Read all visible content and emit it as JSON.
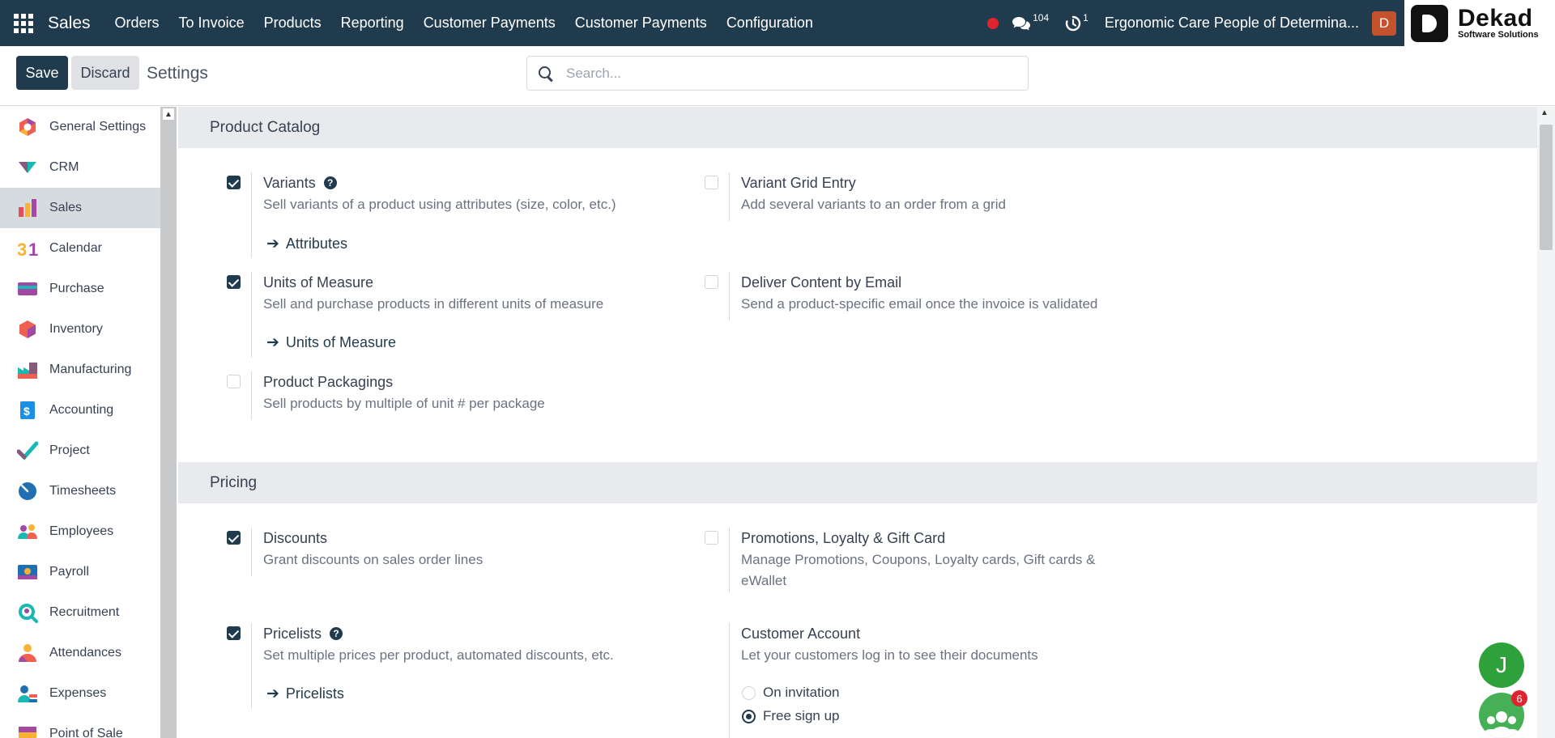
{
  "navbar": {
    "brand": "Sales",
    "menu": [
      "Orders",
      "To Invoice",
      "Products",
      "Reporting",
      "Customer Payments",
      "Customer Payments",
      "Configuration"
    ],
    "messages_count": "104",
    "activities_count": "1",
    "company": "Ergonomic Care People of Determina...",
    "user_initial": "D",
    "partner_logo": {
      "name": "Dekad",
      "tagline": "Software Solutions"
    }
  },
  "control": {
    "save_label": "Save",
    "discard_label": "Discard",
    "breadcrumb": "Settings",
    "search_placeholder": "Search..."
  },
  "sidebar": {
    "items": [
      {
        "label": "General Settings",
        "icon": "general-settings-icon",
        "active": false
      },
      {
        "label": "CRM",
        "icon": "crm-icon",
        "active": false
      },
      {
        "label": "Sales",
        "icon": "sales-icon",
        "active": true
      },
      {
        "label": "Calendar",
        "icon": "calendar-icon",
        "active": false
      },
      {
        "label": "Purchase",
        "icon": "purchase-icon",
        "active": false
      },
      {
        "label": "Inventory",
        "icon": "inventory-icon",
        "active": false
      },
      {
        "label": "Manufacturing",
        "icon": "manufacturing-icon",
        "active": false
      },
      {
        "label": "Accounting",
        "icon": "accounting-icon",
        "active": false
      },
      {
        "label": "Project",
        "icon": "project-icon",
        "active": false
      },
      {
        "label": "Timesheets",
        "icon": "timesheets-icon",
        "active": false
      },
      {
        "label": "Employees",
        "icon": "employees-icon",
        "active": false
      },
      {
        "label": "Payroll",
        "icon": "payroll-icon",
        "active": false
      },
      {
        "label": "Recruitment",
        "icon": "recruitment-icon",
        "active": false
      },
      {
        "label": "Attendances",
        "icon": "attendances-icon",
        "active": false
      },
      {
        "label": "Expenses",
        "icon": "expenses-icon",
        "active": false
      },
      {
        "label": "Point of Sale",
        "icon": "point-of-sale-icon",
        "active": false
      }
    ]
  },
  "sections": {
    "product_catalog": {
      "title": "Product Catalog",
      "variants": {
        "title": "Variants",
        "desc": "Sell variants of a product using attributes (size, color, etc.)",
        "checked": true,
        "link": "Attributes"
      },
      "variant_grid": {
        "title": "Variant Grid Entry",
        "desc": "Add several variants to an order from a grid",
        "checked": false
      },
      "uom": {
        "title": "Units of Measure",
        "desc": "Sell and purchase products in different units of measure",
        "checked": true,
        "link": "Units of Measure"
      },
      "deliver_email": {
        "title": "Deliver Content by Email",
        "desc": "Send a product-specific email once the invoice is validated",
        "checked": false
      },
      "packagings": {
        "title": "Product Packagings",
        "desc": "Sell products by multiple of unit # per package",
        "checked": false
      }
    },
    "pricing": {
      "title": "Pricing",
      "discounts": {
        "title": "Discounts",
        "desc": "Grant discounts on sales order lines",
        "checked": true
      },
      "promotions": {
        "title": "Promotions, Loyalty & Gift Card",
        "desc": "Manage Promotions, Coupons, Loyalty cards, Gift cards & eWallet",
        "checked": false
      },
      "pricelists": {
        "title": "Pricelists",
        "desc": "Set multiple prices per product, automated discounts, etc.",
        "checked": true,
        "link": "Pricelists"
      },
      "customer_account": {
        "title": "Customer Account",
        "desc": "Let your customers log in to see their documents",
        "options": [
          "On invitation",
          "Free sign up"
        ],
        "selected": "Free sign up"
      }
    }
  },
  "floating": {
    "assistant_initial": "J",
    "chat_badge": "6"
  },
  "colors": {
    "navbar": "#1f3b4d",
    "primary": "#1f3b4d",
    "section_bg": "#e8eaed",
    "sidebar_active": "#d6dbe0"
  }
}
